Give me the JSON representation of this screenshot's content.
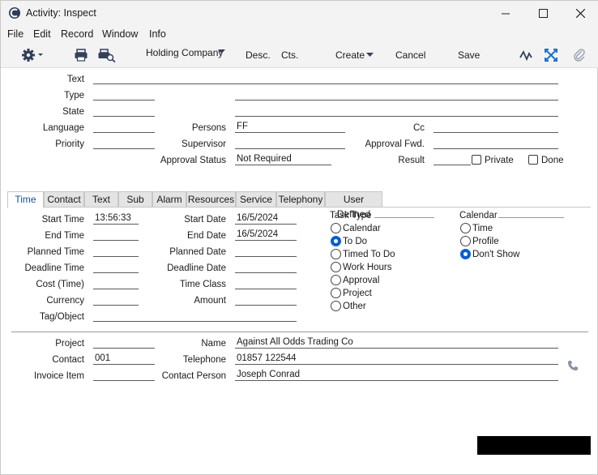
{
  "window": {
    "title": "Activity: Inspect"
  },
  "menu": [
    "File",
    "Edit",
    "Record",
    "Window",
    "Info"
  ],
  "toolbar": {
    "company": "Holding Company",
    "desc": "Desc.",
    "cts": "Cts.",
    "create": "Create",
    "cancel": "Cancel",
    "save": "Save"
  },
  "header": {
    "text_label": "Text",
    "text_value": "",
    "type_label": "Type",
    "type_value": "",
    "type_desc": "",
    "state_label": "State",
    "state_value": "",
    "state_desc": "",
    "language_label": "Language",
    "language_value": "",
    "persons_label": "Persons",
    "persons_value": "FF",
    "cc_label": "Cc",
    "cc_value": "",
    "priority_label": "Priority",
    "priority_value": "",
    "supervisor_label": "Supervisor",
    "supervisor_value": "",
    "approval_fwd_label": "Approval Fwd.",
    "approval_fwd_value": "",
    "approval_status_label": "Approval Status",
    "approval_status_value": "Not Required",
    "result_label": "Result",
    "result_value": "",
    "private_label": "Private",
    "private_checked": false,
    "done_label": "Done",
    "done_checked": false
  },
  "tabs": [
    "Time",
    "Contact",
    "Text",
    "Sub",
    "Alarm",
    "Resources",
    "Service",
    "Telephony",
    "User Defined"
  ],
  "active_tab": "Time",
  "time_tab": {
    "start_time_label": "Start Time",
    "start_time": "13:56:33",
    "end_time_label": "End Time",
    "end_time": "",
    "planned_time_label": "Planned Time",
    "planned_time": "",
    "deadline_time_label": "Deadline Time",
    "deadline_time": "",
    "cost_time_label": "Cost (Time)",
    "cost_time": "",
    "currency_label": "Currency",
    "currency": "",
    "tag_label": "Tag/Object",
    "tag": "",
    "start_date_label": "Start Date",
    "start_date": "16/5/2024",
    "end_date_label": "End Date",
    "end_date": "16/5/2024",
    "planned_date_label": "Planned Date",
    "planned_date": "",
    "deadline_date_label": "Deadline Date",
    "deadline_date": "",
    "time_class_label": "Time Class",
    "time_class": "",
    "amount_label": "Amount",
    "amount": "",
    "task_type_title": "Task Type",
    "task_types": [
      {
        "label": "Calendar",
        "selected": false
      },
      {
        "label": "To Do",
        "selected": true
      },
      {
        "label": "Timed To Do",
        "selected": false
      },
      {
        "label": "Work Hours",
        "selected": false
      },
      {
        "label": "Approval",
        "selected": false
      },
      {
        "label": "Project",
        "selected": false
      },
      {
        "label": "Other",
        "selected": false
      }
    ],
    "calendar_title": "Calendar",
    "calendar_options": [
      {
        "label": "Time",
        "selected": false
      },
      {
        "label": "Profile",
        "selected": false
      },
      {
        "label": "Don't Show",
        "selected": true
      }
    ]
  },
  "footer": {
    "project_label": "Project",
    "project_value": "",
    "contact_label": "Contact",
    "contact_value": "001",
    "invoice_item_label": "Invoice Item",
    "invoice_item_value": "",
    "name_label": "Name",
    "name_value": "Against All Odds Trading Co",
    "telephone_label": "Telephone",
    "telephone_value": "01857 122544",
    "contact_person_label": "Contact Person",
    "contact_person_value": "Joseph Conrad"
  },
  "icons": {
    "app": "app-logo-icon",
    "settings": "gear-icon",
    "print": "printer-icon",
    "print_preview": "print-preview-icon",
    "activity": "activity-pulse-icon",
    "expand": "expand-icon",
    "attach": "paperclip-icon",
    "phone": "phone-icon"
  }
}
